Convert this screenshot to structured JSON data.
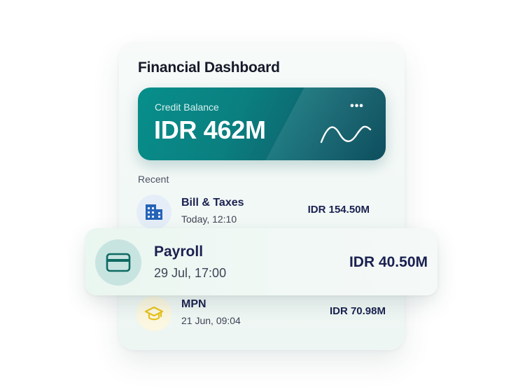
{
  "dashboard": {
    "title": "Financial Dashboard"
  },
  "balance_card": {
    "label": "Credit Balance",
    "amount": "IDR 462M",
    "more_icon": "more-horizontal-icon",
    "trend_icon": "wave-trend-icon",
    "accent_color": "#0b7f80"
  },
  "recent": {
    "label": "Recent",
    "transactions": [
      {
        "name": "Bill & Taxes",
        "date": "Today, 12:10",
        "amount": "IDR 154.50M",
        "icon": "building-icon",
        "icon_color": "#2563b8"
      },
      {
        "name": "MPN",
        "date": "21 Jun, 09:04",
        "amount": "IDR 70.98M",
        "icon": "graduation-cap-icon",
        "icon_color": "#e9c21a"
      }
    ]
  },
  "highlight": {
    "name": "Payroll",
    "date": "29 Jul, 17:00",
    "amount": "IDR 40.50M",
    "icon": "credit-card-icon",
    "icon_color": "#0f6b63"
  }
}
